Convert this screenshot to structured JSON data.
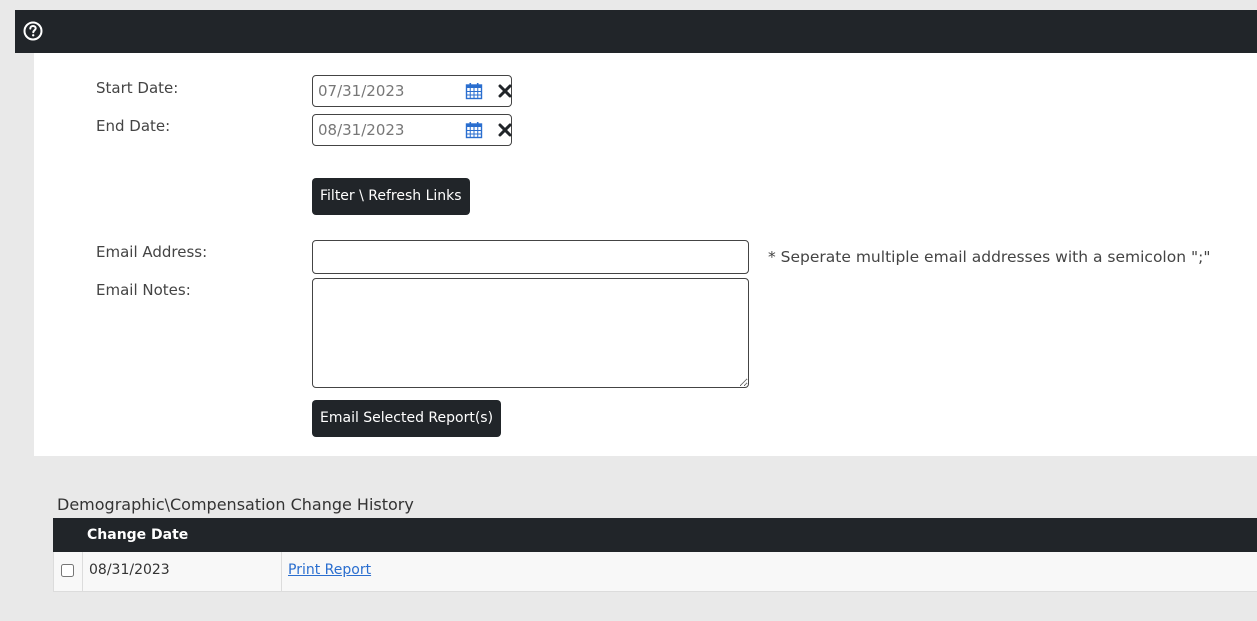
{
  "topbar": {
    "help_icon": "question-circle-icon"
  },
  "filter": {
    "start_date_label": "Start Date:",
    "start_date_value": "07/31/2023",
    "end_date_label": "End Date:",
    "end_date_value": "08/31/2023",
    "calendar_icon": "calendar-icon",
    "clear_icon": "close-icon",
    "refresh_button_label": "Filter \\ Refresh Links"
  },
  "email": {
    "address_label": "Email Address:",
    "address_value": "",
    "address_hint": "* Seperate multiple email addresses with a semicolon \";\"",
    "notes_label": "Email Notes:",
    "notes_value": "",
    "send_button_label": "Email Selected Report(s)"
  },
  "history": {
    "title": "Demographic\\Compensation Change History",
    "columns": [
      "Change Date"
    ],
    "rows": [
      {
        "checked": false,
        "change_date": "08/31/2023",
        "link_label": "Print Report"
      }
    ]
  },
  "colors": {
    "dark": "#212529",
    "link": "#2a6ecf",
    "calendar_blue": "#2a6ecf",
    "page_bg": "#e9e9e9"
  }
}
